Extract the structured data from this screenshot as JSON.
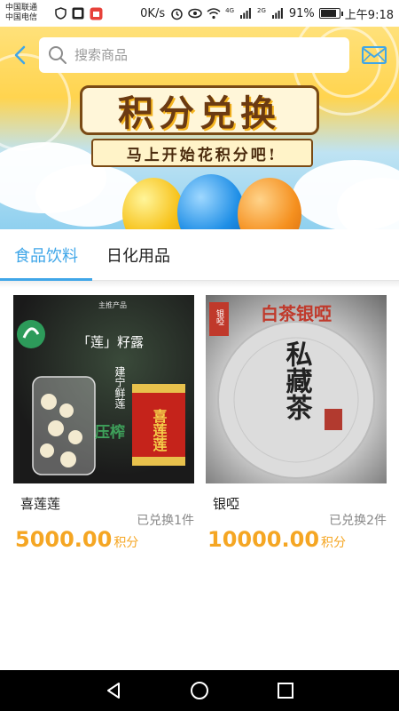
{
  "status_bar": {
    "carrier_1": "中国联通",
    "carrier_2": "中国电信",
    "speed": "0K/s",
    "net_4g": "4G",
    "net_2g": "2G",
    "battery_percent": "91%",
    "battery_level": 0.91,
    "time": "上午9:18"
  },
  "search": {
    "placeholder": "搜索商品"
  },
  "banner": {
    "title": "积分兑换",
    "subtitle": "马上开始花积分吧!"
  },
  "tabs": [
    {
      "label": "食品饮料",
      "active": true
    },
    {
      "label": "日化用品",
      "active": false
    }
  ],
  "products": [
    {
      "name": "喜莲莲",
      "price": "5000.00",
      "unit": "积分",
      "redeemed": "已兑换1件",
      "image_texts": [
        "主推产品",
        "「莲」籽露",
        "建宁鲜莲",
        "压榨",
        "喜莲莲"
      ]
    },
    {
      "name": "银啞",
      "price": "10000.00",
      "unit": "积分",
      "redeemed": "已兑换2件",
      "image_texts": [
        "白茶银啞",
        "私藏茶",
        "银啞"
      ]
    }
  ],
  "colors": {
    "accent": "#3fa6e8",
    "price": "#f5a623"
  }
}
